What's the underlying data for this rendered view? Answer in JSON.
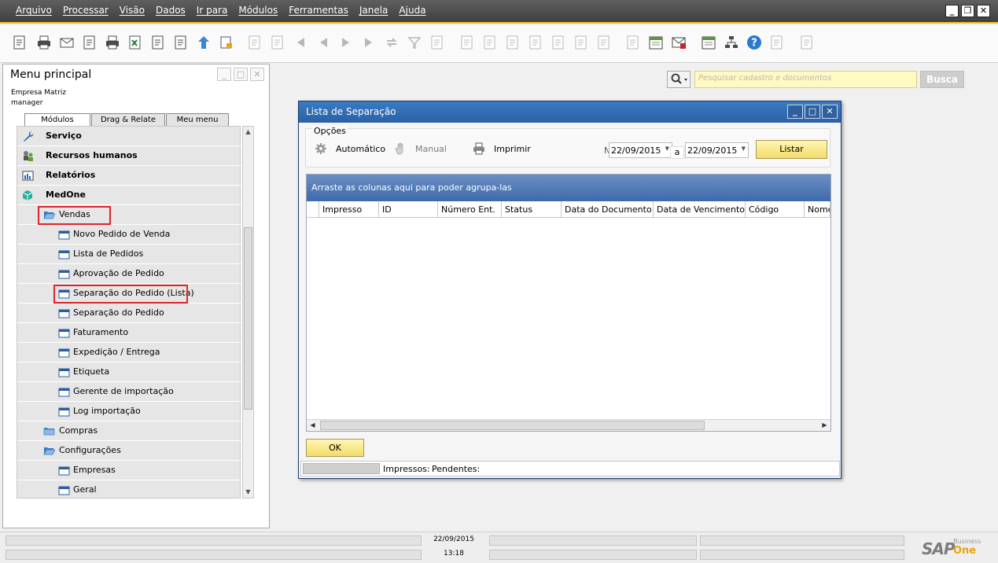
{
  "menubar": {
    "items": [
      "Arquivo",
      "Processar",
      "Visão",
      "Dados",
      "Ir para",
      "Módulos",
      "Ferramentas",
      "Janela",
      "Ajuda"
    ]
  },
  "window_controls": [
    "minimize-icon",
    "restore-icon",
    "close-icon"
  ],
  "toolbar": {
    "icons": [
      "print-preview-icon",
      "print-icon",
      "email-icon",
      "sms-icon",
      "fax-icon",
      "excel-icon",
      "word-icon",
      "pdf-icon",
      "launch-icon",
      "lock-icon",
      "find-icon",
      "add-icon",
      "first-record-icon",
      "previous-record-icon",
      "next-record-icon",
      "last-record-icon",
      "refresh-icon",
      "filter-icon",
      "sort-icon",
      "base-document-icon",
      "target-document-icon",
      "gross-profit-icon",
      "base-price-icon",
      "payment-means-icon",
      "payment-icon",
      "volume-weight-icon",
      "settings-icon",
      "journal-icon",
      "message-icon",
      "calendar-icon",
      "tree-icon",
      "help-icon",
      "form-settings-icon",
      "layout-icon"
    ]
  },
  "left_panel": {
    "title": "Menu principal",
    "company": "Empresa Matriz",
    "user": "manager",
    "tabs": [
      "Módulos",
      "Drag & Relate",
      "Meu menu"
    ],
    "tree": [
      {
        "level": 0,
        "label": "Serviço",
        "icon": "wrench-icon"
      },
      {
        "level": 0,
        "label": "Recursos humanos",
        "icon": "people-icon"
      },
      {
        "level": 0,
        "label": "Relatórios",
        "icon": "report-icon"
      },
      {
        "level": 0,
        "label": "MedOne",
        "icon": "cube-icon"
      },
      {
        "level": 1,
        "label": "Vendas",
        "icon": "folder-open-icon",
        "highlight": true
      },
      {
        "level": 2,
        "label": "Novo Pedido de Venda",
        "icon": "form-icon"
      },
      {
        "level": 2,
        "label": "Lista de Pedidos",
        "icon": "form-icon"
      },
      {
        "level": 2,
        "label": "Aprovação de Pedido",
        "icon": "form-icon"
      },
      {
        "level": 2,
        "label": "Separação do Pedido (Lista)",
        "icon": "form-icon",
        "highlight": true
      },
      {
        "level": 2,
        "label": "Separação do Pedido",
        "icon": "form-icon"
      },
      {
        "level": 2,
        "label": "Faturamento",
        "icon": "form-icon"
      },
      {
        "level": 2,
        "label": "Expedição / Entrega",
        "icon": "form-icon"
      },
      {
        "level": 2,
        "label": "Etiqueta",
        "icon": "form-icon"
      },
      {
        "level": 2,
        "label": "Gerente de importação",
        "icon": "form-icon"
      },
      {
        "level": 2,
        "label": "Log importação",
        "icon": "form-icon"
      },
      {
        "level": 1,
        "label": "Compras",
        "icon": "folder-icon"
      },
      {
        "level": 1,
        "label": "Configurações",
        "icon": "folder-open-icon"
      },
      {
        "level": 2,
        "label": "Empresas",
        "icon": "form-icon"
      },
      {
        "level": 2,
        "label": "Geral",
        "icon": "form-icon"
      }
    ]
  },
  "search": {
    "placeholder": "Pesquisar cadastro e documentos",
    "button": "Busca"
  },
  "dialog": {
    "title": "Lista de Separação",
    "options_label": "Opções",
    "option_auto": "Automático",
    "option_manual": "Manual",
    "option_print": "Imprimir",
    "n_label": "N",
    "date_from": "22/09/2015",
    "date_sep": "a",
    "date_to": "22/09/2015",
    "list_button": "Listar",
    "group_hint": "Arraste as colunas aqui para poder agrupa-las",
    "columns": [
      "Impresso",
      "ID",
      "Número Ent.",
      "Status",
      "Data do Documento",
      "Data de Vencimento",
      "Código",
      "Nome"
    ],
    "ok_button": "OK",
    "printed_label": "Impressos:",
    "pending_label": "Pendentes:"
  },
  "statusbar": {
    "date": "22/09/2015",
    "time": "13:18",
    "brand_sap": "SAP",
    "brand_business": "Business",
    "brand_one": "One"
  },
  "colors": {
    "menubar": "#4b4b4b",
    "accent_yellow": "#f0c020",
    "dialog_title": "#2f6cb3",
    "highlight_red": "#e0242c"
  }
}
